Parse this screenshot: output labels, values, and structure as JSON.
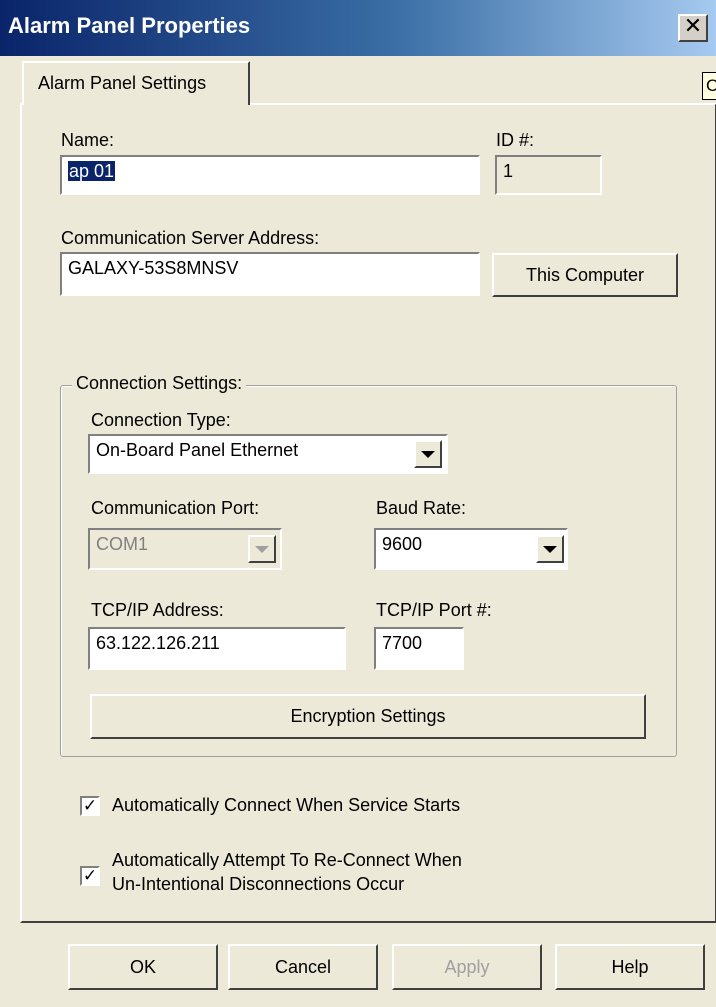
{
  "window": {
    "title": "Alarm Panel Properties",
    "close_glyph": "✕"
  },
  "tabs": [
    {
      "label": "Alarm Panel Settings",
      "active": true
    }
  ],
  "tooltip": {
    "text": "Cl"
  },
  "form": {
    "name": {
      "label": "Name:",
      "value": "ap 01"
    },
    "id": {
      "label": "ID #:",
      "value": "1"
    },
    "server": {
      "label": "Communication Server Address:",
      "value": "GALAXY-53S8MNSV",
      "button_label": "This Computer"
    },
    "connection": {
      "group_label": "Connection Settings:",
      "type": {
        "label": "Connection Type:",
        "value": "On-Board Panel Ethernet"
      },
      "port": {
        "label": "Communication Port:",
        "value": "COM1",
        "enabled": false
      },
      "baud": {
        "label": "Baud Rate:",
        "value": "9600"
      },
      "tcp_address": {
        "label": "TCP/IP Address:",
        "value": "63.122.126.211"
      },
      "tcp_port": {
        "label": "TCP/IP Port #:",
        "value": "7700"
      },
      "encryption_button": "Encryption Settings"
    },
    "auto_connect": {
      "label": "Automatically Connect When Service Starts",
      "checked": true
    },
    "auto_reconnect": {
      "label_line1": "Automatically Attempt To Re-Connect When",
      "label_line2": "Un-Intentional Disconnections Occur",
      "checked": true
    }
  },
  "check_glyph": "✓",
  "footer": {
    "ok": "OK",
    "cancel": "Cancel",
    "apply": "Apply",
    "help": "Help"
  },
  "icons": {
    "close": "close-icon",
    "dropdown": "chevron-down-icon",
    "check": "checkmark-icon"
  },
  "colors": {
    "dialog_bg": "#ece9d8",
    "titlebar_start": "#0a246a",
    "titlebar_end": "#a6caf0",
    "selection": "#0a246a"
  }
}
